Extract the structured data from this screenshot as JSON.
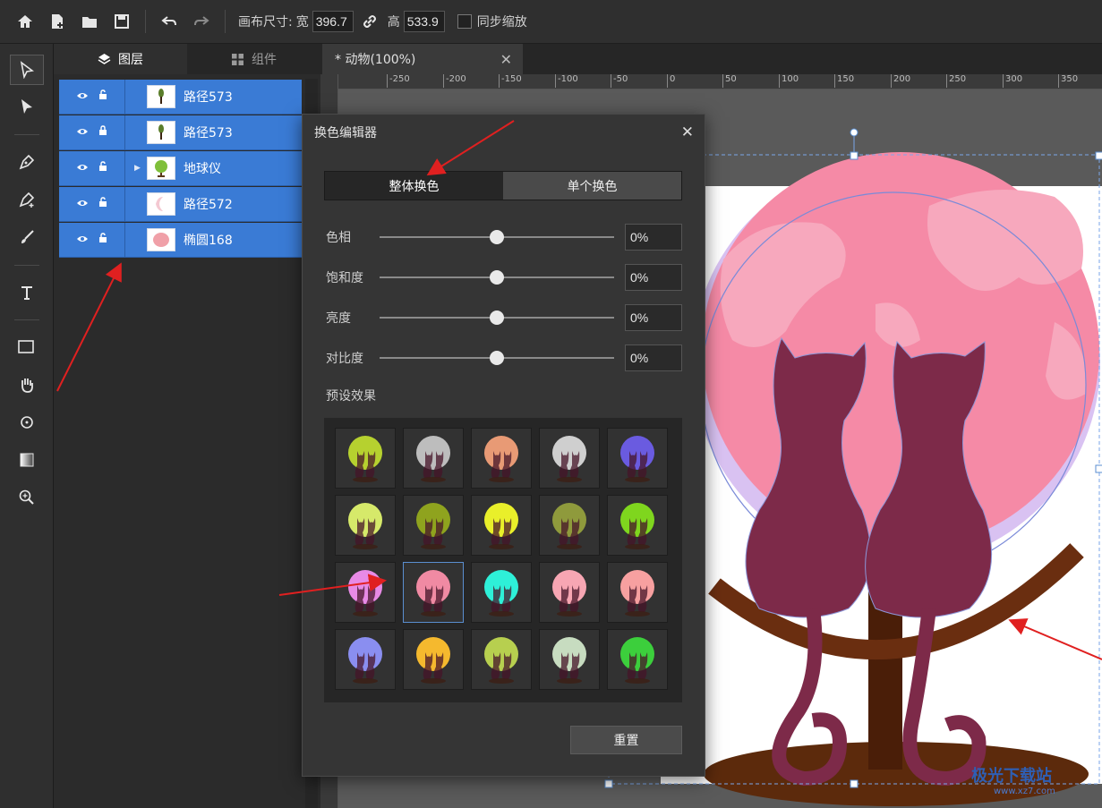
{
  "toolbar": {
    "canvas_size_label": "画布尺寸:",
    "width_label": "宽",
    "width_value": "396.7",
    "height_label": "高",
    "height_value": "533.9",
    "sync_scale_label": "同步缩放"
  },
  "layers_panel": {
    "tabs": [
      {
        "label": "图层",
        "icon": "layers-icon"
      },
      {
        "label": "组件",
        "icon": "grid-icon"
      }
    ],
    "rows": [
      {
        "name": "路径573",
        "thumb": "tree-thumb",
        "locked": false
      },
      {
        "name": "路径573",
        "thumb": "tree-thumb",
        "locked": true
      },
      {
        "name": "地球仪",
        "thumb": "globe-thumb",
        "locked": false,
        "has_children": true
      },
      {
        "name": "路径572",
        "thumb": "crescent-thumb",
        "locked": false
      },
      {
        "name": "椭圆168",
        "thumb": "pink-ellipse-thumb",
        "locked": false
      }
    ]
  },
  "document": {
    "tab_label": "* 动物(100%)"
  },
  "ruler": {
    "ticks": [
      "-250",
      "-200",
      "-150",
      "-100",
      "-50",
      "0",
      "50",
      "100",
      "150",
      "200",
      "250",
      "300",
      "350"
    ]
  },
  "dialog": {
    "title": "换色编辑器",
    "segments": [
      "整体换色",
      "单个换色"
    ],
    "sliders": [
      {
        "label": "色相",
        "value": "0%",
        "level": 0.5
      },
      {
        "label": "饱和度",
        "value": "0%",
        "level": 0.5
      },
      {
        "label": "亮度",
        "value": "0%",
        "level": 0.5
      },
      {
        "label": "对比度",
        "value": "0%",
        "level": 0.5
      }
    ],
    "preset_title": "预设效果",
    "presets": [
      "#b6d12f",
      "#bdbdbd",
      "#e89a75",
      "#cfcfcf",
      "#6a5be0",
      "#d6e96a",
      "#8fa31e",
      "#e9ef2a",
      "#8f9a3c",
      "#7fd61e",
      "#e88ae6",
      "#f08aa3",
      "#2ef0d8",
      "#f7a6b3",
      "#f7a0a0",
      "#8a8ef0",
      "#f5b92e",
      "#b7cf4f",
      "#c7dcc0",
      "#3ccf3c"
    ],
    "selected_preset": 11,
    "reset_label": "重置"
  },
  "watermark": {
    "title": "极光下载站",
    "url": "www.xz7.com"
  }
}
